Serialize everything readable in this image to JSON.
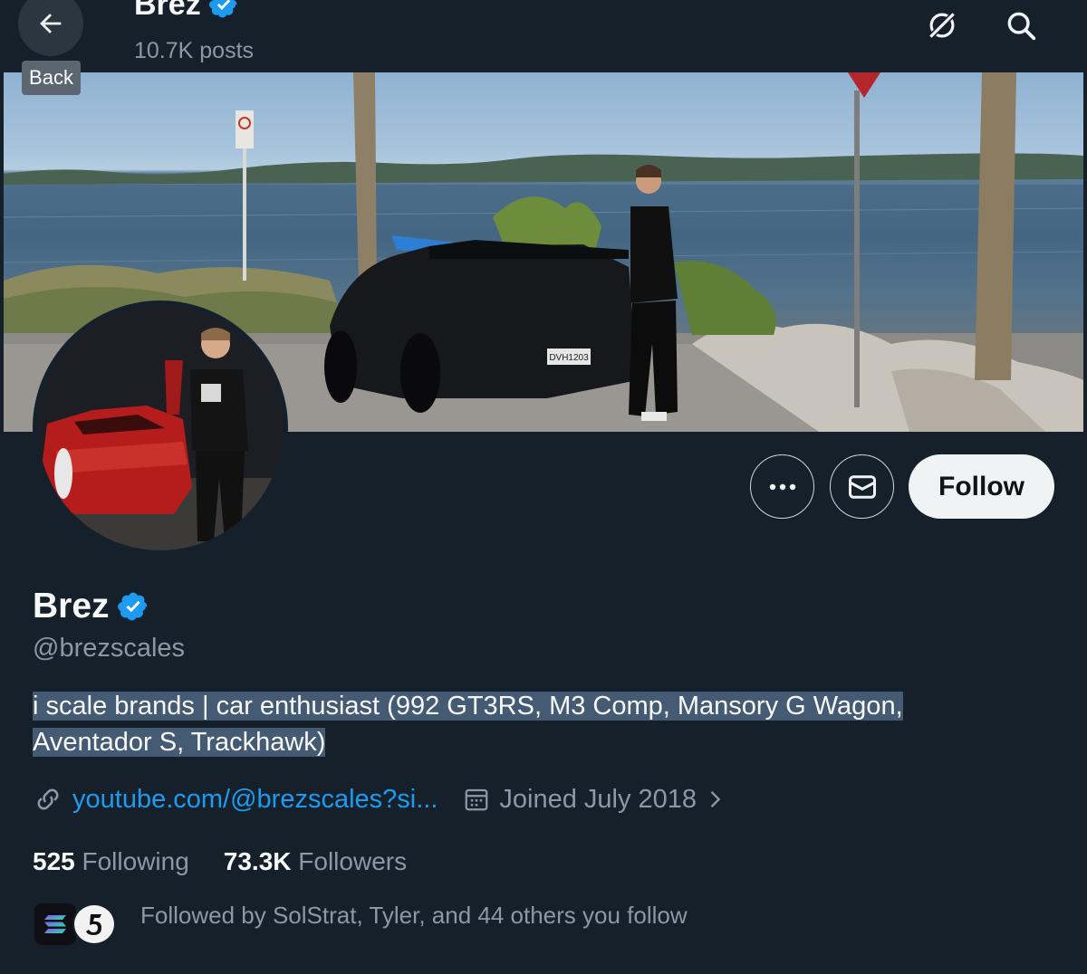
{
  "header": {
    "back_tooltip": "Back",
    "title": "Brez",
    "posts_count": "10.7K posts",
    "icons": [
      "arrow-left-icon",
      "grok-icon",
      "search-icon"
    ]
  },
  "banner": {
    "license_plate": "DVH1203"
  },
  "actions": {
    "more_icon": "more-icon",
    "message_icon": "message-icon",
    "follow_label": "Follow"
  },
  "profile": {
    "name": "Brez",
    "handle": "@brezscales",
    "bio": "i scale brands | car enthusiast (992 GT3RS, M3 Comp, Mansory G Wagon, Aventador S, Trackhawk)",
    "link": "youtube.com/@brezscales?si...",
    "joined": "Joined July 2018"
  },
  "stats": {
    "following_count": "525",
    "following_label": "Following",
    "followers_count": "73.3K",
    "followers_label": "Followers"
  },
  "followed_by": "Followed by SolStrat, Tyler, and 44 others you follow",
  "colors": {
    "background": "#15202b",
    "accent": "#1d9bf0",
    "verified": "#1d9bf0",
    "secondary_text": "#8b98a5",
    "selection": "#445b73"
  }
}
